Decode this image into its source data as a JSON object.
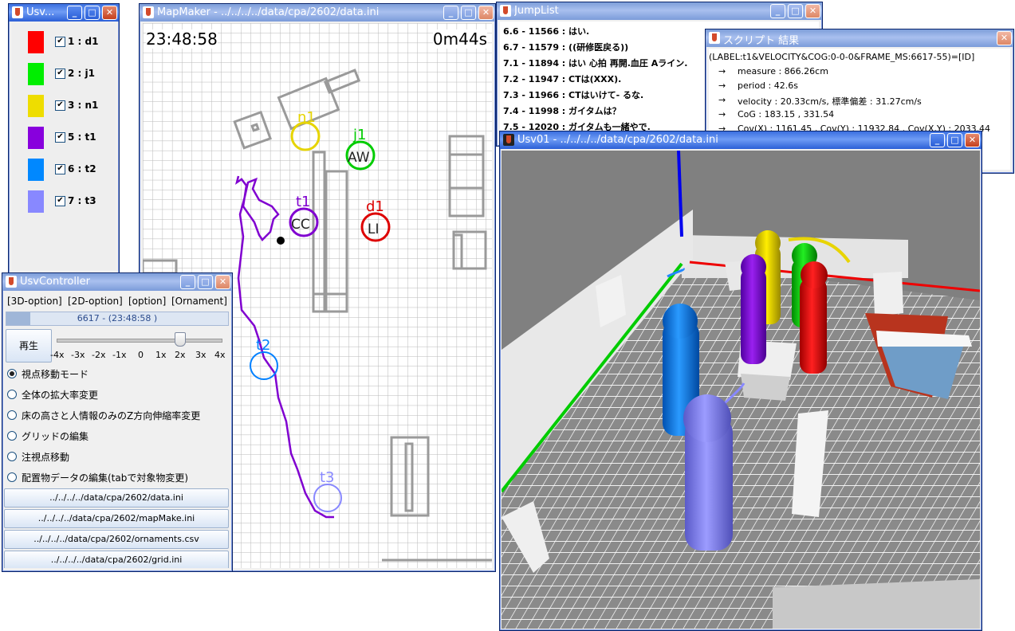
{
  "usv_legend": {
    "title": "Usv...",
    "items": [
      {
        "label": "1 : d1",
        "color": "#ff0000",
        "checked": true
      },
      {
        "label": "2 : j1",
        "color": "#00ee00",
        "checked": true
      },
      {
        "label": "3 : n1",
        "color": "#eedd00",
        "checked": true
      },
      {
        "label": "5 : t1",
        "color": "#8800dd",
        "checked": true
      },
      {
        "label": "6 : t2",
        "color": "#0088ff",
        "checked": true
      },
      {
        "label": "7 : t3",
        "color": "#8888ff",
        "checked": true
      }
    ],
    "check_glyph": "✔"
  },
  "mapmaker": {
    "title": "MapMaker - ../../../../data/cpa/2602/data.ini",
    "clock": "23:48:58",
    "elapsed": "0m44s",
    "labels": {
      "n1": "n1",
      "j1": "j1",
      "t1": "t1",
      "d1": "d1",
      "t2": "t2",
      "t3": "t3",
      "aw": "AW",
      "cc": "CC",
      "li": "LI"
    }
  },
  "controller": {
    "title": "UsvController",
    "menus": [
      "[3D-option]",
      "[2D-option]",
      "[option]",
      "[Ornament]"
    ],
    "frame_status": "6617 - (23:48:58 )",
    "play_label": "再生",
    "speed_ticks": [
      "-4x",
      "-3x",
      "-2x",
      "-1x",
      "0",
      "1x",
      "2x",
      "3x",
      "4x"
    ],
    "modes": [
      {
        "label": "視点移動モード",
        "selected": true
      },
      {
        "label": "全体の拡大率変更",
        "selected": false
      },
      {
        "label": "床の高さと人情報のみのZ方向伸縮率変更",
        "selected": false
      },
      {
        "label": "グリッドの編集",
        "selected": false
      },
      {
        "label": "注視点移動",
        "selected": false
      },
      {
        "label": "配置物データの編集(tabで対象物変更)",
        "selected": false
      }
    ],
    "files": [
      "../../../../data/cpa/2602/data.ini",
      "../../../../data/cpa/2602/mapMake.ini",
      "../../../../data/cpa/2602/ornaments.csv",
      "../../../../data/cpa/2602/grid.ini"
    ]
  },
  "jumplist": {
    "title": "JumpList",
    "items": [
      "6.6 - 11566 : はい.",
      "6.7 - 11579 : ((研修医戻る))",
      "7.1 - 11894 : はい 心拍 再開.血圧 Aライン.",
      "7.2 - 11947 : CTは(XXX).",
      "7.3 - 11966 : CTはいけて- るな.",
      "7.4 - 11998 : ガイタムは？",
      "7.5 - 12020 : ガイタムも一緒やで."
    ]
  },
  "script_result": {
    "title": "スクリプト 結果",
    "query": "(LABEL:t1&VELOCITY&COG:0-0-0&FRAME_MS:6617-55)=[ID]",
    "arrow": "→",
    "lines": [
      "measure : 866.26cm",
      "period : 42.6s",
      "velocity : 20.33cm/s, 標準偏差 : 31.27cm/s",
      "CoG : 183.15 , 331.54",
      "Cov(X) : 1161.45    ,    Cov(Y) : 11932.84    ,    Cov(X,Y) : 2033.44"
    ]
  },
  "usv01": {
    "title": "Usv01 - ../../../../data/cpa/2602/data.ini"
  },
  "window_buttons": {
    "minimize": "_",
    "maximize": "□",
    "close": "✕"
  }
}
